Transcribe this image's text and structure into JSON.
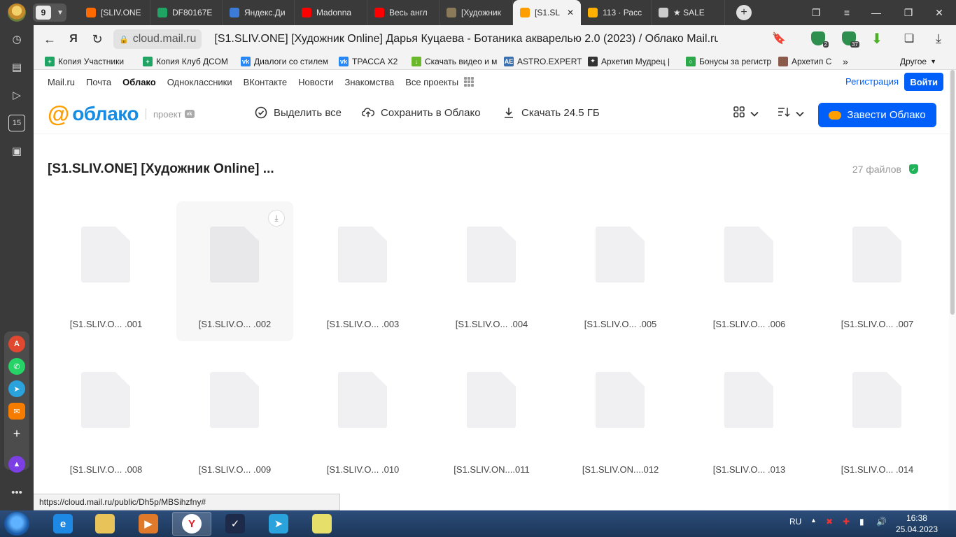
{
  "browser": {
    "tab_count": "9",
    "tabs": [
      {
        "label": "[SLIV.ONE",
        "color": "#ff6a00"
      },
      {
        "label": "DF80167E",
        "color": "#1fa463"
      },
      {
        "label": "Яндекс.Ди",
        "color": "#3d7bd8"
      },
      {
        "label": "Madonna",
        "color": "#ff0000"
      },
      {
        "label": "Весь англ",
        "color": "#ff0000"
      },
      {
        "label": "[Художник",
        "color": "#8a7a5a"
      },
      {
        "label": "[S1.SLIV",
        "color": "#ff9e00",
        "active": true
      },
      {
        "label": "113 · Расс",
        "color": "#ffb000"
      },
      {
        "label": "★ SALE",
        "color": "#cccccc"
      }
    ],
    "active_tab_close": "✕",
    "new_tab": "+",
    "address": {
      "domain": "cloud.mail.ru",
      "title": "[S1.SLIV.ONE] [Художник Online] Дарья Куцаева - Ботаника акварелью 2.0 (2023) / Облако Mail.ru"
    },
    "extension_badges": [
      "2",
      "37"
    ],
    "bookmarks": [
      {
        "label": "Копия Участники",
        "color": "#1fa463",
        "glyph": "+"
      },
      {
        "label": "Копия Клуб ДСОМ",
        "color": "#1fa463",
        "glyph": "+"
      },
      {
        "label": "Диалоги со стилем",
        "color": "#2787f5",
        "glyph": "vk"
      },
      {
        "label": "ТРАССА Х2",
        "color": "#2787f5",
        "glyph": "vk"
      },
      {
        "label": "Скачать видео и м",
        "color": "#6ab82a",
        "glyph": "↓"
      },
      {
        "label": "ASTRO.EXPERT",
        "color": "#3a6fb0",
        "glyph": "AE"
      },
      {
        "label": "Архетип Мудрец |",
        "color": "#333333",
        "glyph": "✦"
      },
      {
        "label": "Бонусы за регистр",
        "color": "#2aa84a",
        "glyph": "○"
      },
      {
        "label": "Архетип С",
        "color": "#8a5a4a",
        "glyph": ""
      }
    ],
    "bookmarks_more": "»",
    "bookmarks_other": "Другое",
    "status_url": "https://cloud.mail.ru/public/Dh5p/MBSihzfny#"
  },
  "portal_nav": {
    "items": [
      "Mail.ru",
      "Почта",
      "Облако",
      "Одноклассники",
      "ВКонтакте",
      "Новости",
      "Знакомства",
      "Все проекты"
    ],
    "active": "Облако",
    "register": "Регистрация",
    "login": "Войти"
  },
  "cloud_header": {
    "logo_text": "облако",
    "logo_project": "проект",
    "logo_vk": "vk",
    "select_all": "Выделить все",
    "save_to_cloud": "Сохранить в Облако",
    "download": "Скачать 24.5 ГБ",
    "get_cloud": "Завести Облако"
  },
  "folder": {
    "title": "[S1.SLIV.ONE] [Художник Online] ...",
    "file_count": "27 файлов"
  },
  "files": [
    "[S1.SLIV.O...  .001",
    "[S1.SLIV.O...  .002",
    "[S1.SLIV.O...  .003",
    "[S1.SLIV.O...  .004",
    "[S1.SLIV.O...  .005",
    "[S1.SLIV.O...  .006",
    "[S1.SLIV.O...  .007",
    "[S1.SLIV.O...  .008",
    "[S1.SLIV.O...  .009",
    "[S1.SLIV.O...  .010",
    "[S1.SLIV.ON....011",
    "[S1.SLIV.ON....012",
    "[S1.SLIV.O...  .013",
    "[S1.SLIV.O...  .014"
  ],
  "taskbar": {
    "language": "RU",
    "time": "16:38",
    "date": "25.04.2023",
    "apps": [
      {
        "name": "ie",
        "color": "#1e88e5",
        "glyph": "e"
      },
      {
        "name": "explorer",
        "color": "#e8c35a",
        "glyph": ""
      },
      {
        "name": "media-player",
        "color": "#e07a2a",
        "glyph": "▶"
      },
      {
        "name": "yandex-browser",
        "color": "#ffffff",
        "glyph": "Y",
        "active": true
      },
      {
        "name": "vpn",
        "color": "#1d2a4a",
        "glyph": "✓"
      },
      {
        "name": "telegram",
        "color": "#2aa3dd",
        "glyph": "➤"
      },
      {
        "name": "notes",
        "color": "#e6df6a",
        "glyph": ""
      }
    ]
  }
}
